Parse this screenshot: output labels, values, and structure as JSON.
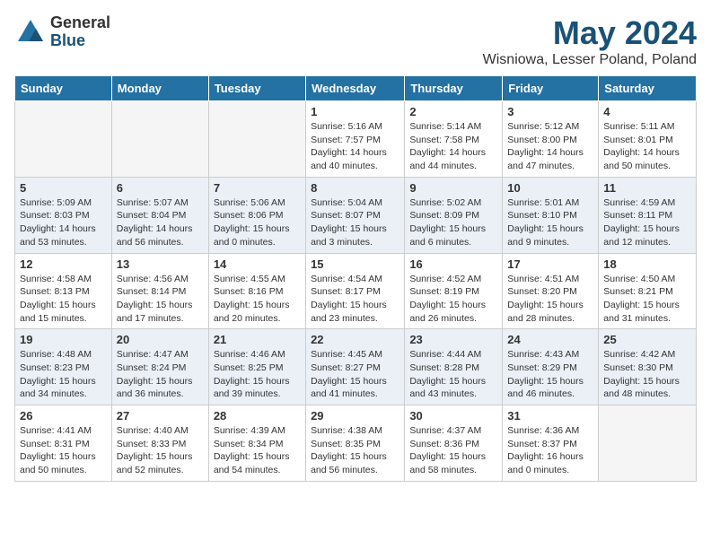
{
  "logo": {
    "general": "General",
    "blue": "Blue"
  },
  "title": "May 2024",
  "location": "Wisniowa, Lesser Poland, Poland",
  "weekdays": [
    "Sunday",
    "Monday",
    "Tuesday",
    "Wednesday",
    "Thursday",
    "Friday",
    "Saturday"
  ],
  "weeks": [
    [
      {
        "day": "",
        "info": ""
      },
      {
        "day": "",
        "info": ""
      },
      {
        "day": "",
        "info": ""
      },
      {
        "day": "1",
        "info": "Sunrise: 5:16 AM\nSunset: 7:57 PM\nDaylight: 14 hours\nand 40 minutes."
      },
      {
        "day": "2",
        "info": "Sunrise: 5:14 AM\nSunset: 7:58 PM\nDaylight: 14 hours\nand 44 minutes."
      },
      {
        "day": "3",
        "info": "Sunrise: 5:12 AM\nSunset: 8:00 PM\nDaylight: 14 hours\nand 47 minutes."
      },
      {
        "day": "4",
        "info": "Sunrise: 5:11 AM\nSunset: 8:01 PM\nDaylight: 14 hours\nand 50 minutes."
      }
    ],
    [
      {
        "day": "5",
        "info": "Sunrise: 5:09 AM\nSunset: 8:03 PM\nDaylight: 14 hours\nand 53 minutes."
      },
      {
        "day": "6",
        "info": "Sunrise: 5:07 AM\nSunset: 8:04 PM\nDaylight: 14 hours\nand 56 minutes."
      },
      {
        "day": "7",
        "info": "Sunrise: 5:06 AM\nSunset: 8:06 PM\nDaylight: 15 hours\nand 0 minutes."
      },
      {
        "day": "8",
        "info": "Sunrise: 5:04 AM\nSunset: 8:07 PM\nDaylight: 15 hours\nand 3 minutes."
      },
      {
        "day": "9",
        "info": "Sunrise: 5:02 AM\nSunset: 8:09 PM\nDaylight: 15 hours\nand 6 minutes."
      },
      {
        "day": "10",
        "info": "Sunrise: 5:01 AM\nSunset: 8:10 PM\nDaylight: 15 hours\nand 9 minutes."
      },
      {
        "day": "11",
        "info": "Sunrise: 4:59 AM\nSunset: 8:11 PM\nDaylight: 15 hours\nand 12 minutes."
      }
    ],
    [
      {
        "day": "12",
        "info": "Sunrise: 4:58 AM\nSunset: 8:13 PM\nDaylight: 15 hours\nand 15 minutes."
      },
      {
        "day": "13",
        "info": "Sunrise: 4:56 AM\nSunset: 8:14 PM\nDaylight: 15 hours\nand 17 minutes."
      },
      {
        "day": "14",
        "info": "Sunrise: 4:55 AM\nSunset: 8:16 PM\nDaylight: 15 hours\nand 20 minutes."
      },
      {
        "day": "15",
        "info": "Sunrise: 4:54 AM\nSunset: 8:17 PM\nDaylight: 15 hours\nand 23 minutes."
      },
      {
        "day": "16",
        "info": "Sunrise: 4:52 AM\nSunset: 8:19 PM\nDaylight: 15 hours\nand 26 minutes."
      },
      {
        "day": "17",
        "info": "Sunrise: 4:51 AM\nSunset: 8:20 PM\nDaylight: 15 hours\nand 28 minutes."
      },
      {
        "day": "18",
        "info": "Sunrise: 4:50 AM\nSunset: 8:21 PM\nDaylight: 15 hours\nand 31 minutes."
      }
    ],
    [
      {
        "day": "19",
        "info": "Sunrise: 4:48 AM\nSunset: 8:23 PM\nDaylight: 15 hours\nand 34 minutes."
      },
      {
        "day": "20",
        "info": "Sunrise: 4:47 AM\nSunset: 8:24 PM\nDaylight: 15 hours\nand 36 minutes."
      },
      {
        "day": "21",
        "info": "Sunrise: 4:46 AM\nSunset: 8:25 PM\nDaylight: 15 hours\nand 39 minutes."
      },
      {
        "day": "22",
        "info": "Sunrise: 4:45 AM\nSunset: 8:27 PM\nDaylight: 15 hours\nand 41 minutes."
      },
      {
        "day": "23",
        "info": "Sunrise: 4:44 AM\nSunset: 8:28 PM\nDaylight: 15 hours\nand 43 minutes."
      },
      {
        "day": "24",
        "info": "Sunrise: 4:43 AM\nSunset: 8:29 PM\nDaylight: 15 hours\nand 46 minutes."
      },
      {
        "day": "25",
        "info": "Sunrise: 4:42 AM\nSunset: 8:30 PM\nDaylight: 15 hours\nand 48 minutes."
      }
    ],
    [
      {
        "day": "26",
        "info": "Sunrise: 4:41 AM\nSunset: 8:31 PM\nDaylight: 15 hours\nand 50 minutes."
      },
      {
        "day": "27",
        "info": "Sunrise: 4:40 AM\nSunset: 8:33 PM\nDaylight: 15 hours\nand 52 minutes."
      },
      {
        "day": "28",
        "info": "Sunrise: 4:39 AM\nSunset: 8:34 PM\nDaylight: 15 hours\nand 54 minutes."
      },
      {
        "day": "29",
        "info": "Sunrise: 4:38 AM\nSunset: 8:35 PM\nDaylight: 15 hours\nand 56 minutes."
      },
      {
        "day": "30",
        "info": "Sunrise: 4:37 AM\nSunset: 8:36 PM\nDaylight: 15 hours\nand 58 minutes."
      },
      {
        "day": "31",
        "info": "Sunrise: 4:36 AM\nSunset: 8:37 PM\nDaylight: 16 hours\nand 0 minutes."
      },
      {
        "day": "",
        "info": ""
      }
    ]
  ]
}
